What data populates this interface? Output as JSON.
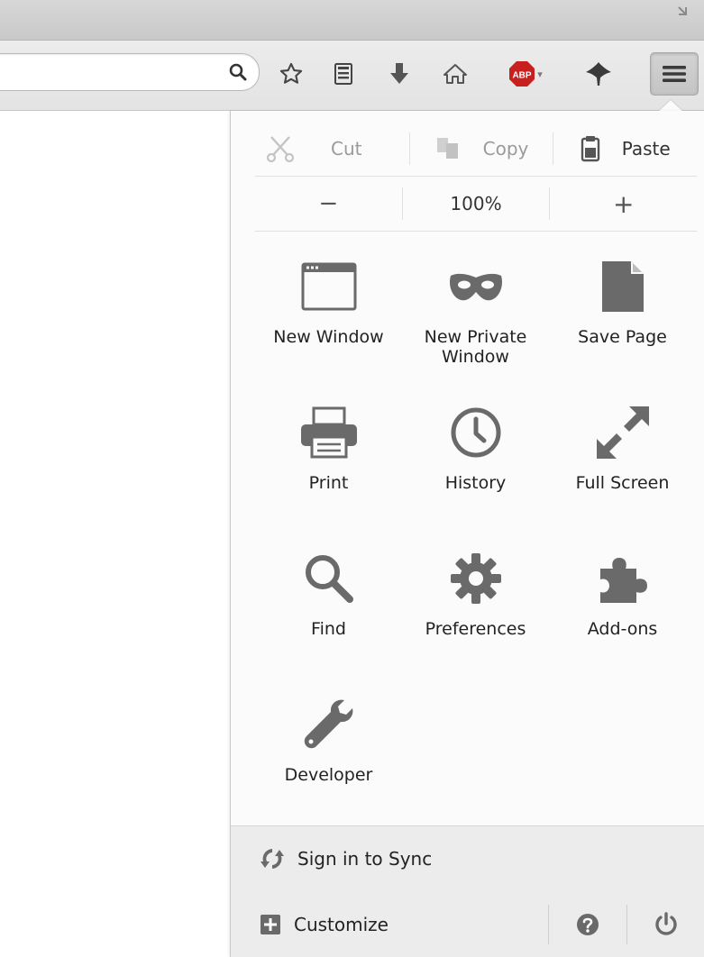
{
  "edit": {
    "cut_label": "Cut",
    "copy_label": "Copy",
    "paste_label": "Paste"
  },
  "zoom": {
    "minus_label": "−",
    "level": "100%",
    "plus_label": "+"
  },
  "tiles": [
    {
      "label": "New Window",
      "icon": "window-icon"
    },
    {
      "label": "New Private\nWindow",
      "icon": "mask-icon"
    },
    {
      "label": "Save Page",
      "icon": "page-icon"
    },
    {
      "label": "Print",
      "icon": "printer-icon"
    },
    {
      "label": "History",
      "icon": "clock-icon"
    },
    {
      "label": "Full Screen",
      "icon": "expand-arrows-icon"
    },
    {
      "label": "Find",
      "icon": "magnifier-icon"
    },
    {
      "label": "Preferences",
      "icon": "gear-icon"
    },
    {
      "label": "Add-ons",
      "icon": "puzzle-icon"
    },
    {
      "label": "Developer",
      "icon": "wrench-icon"
    }
  ],
  "sync": {
    "label": "Sign in to Sync"
  },
  "footer": {
    "customize_label": "Customize"
  },
  "toolbar": {
    "abp_text": "ABP"
  },
  "colors": {
    "icon_gray": "#6a6a6a",
    "abp_red": "#c7201f"
  }
}
